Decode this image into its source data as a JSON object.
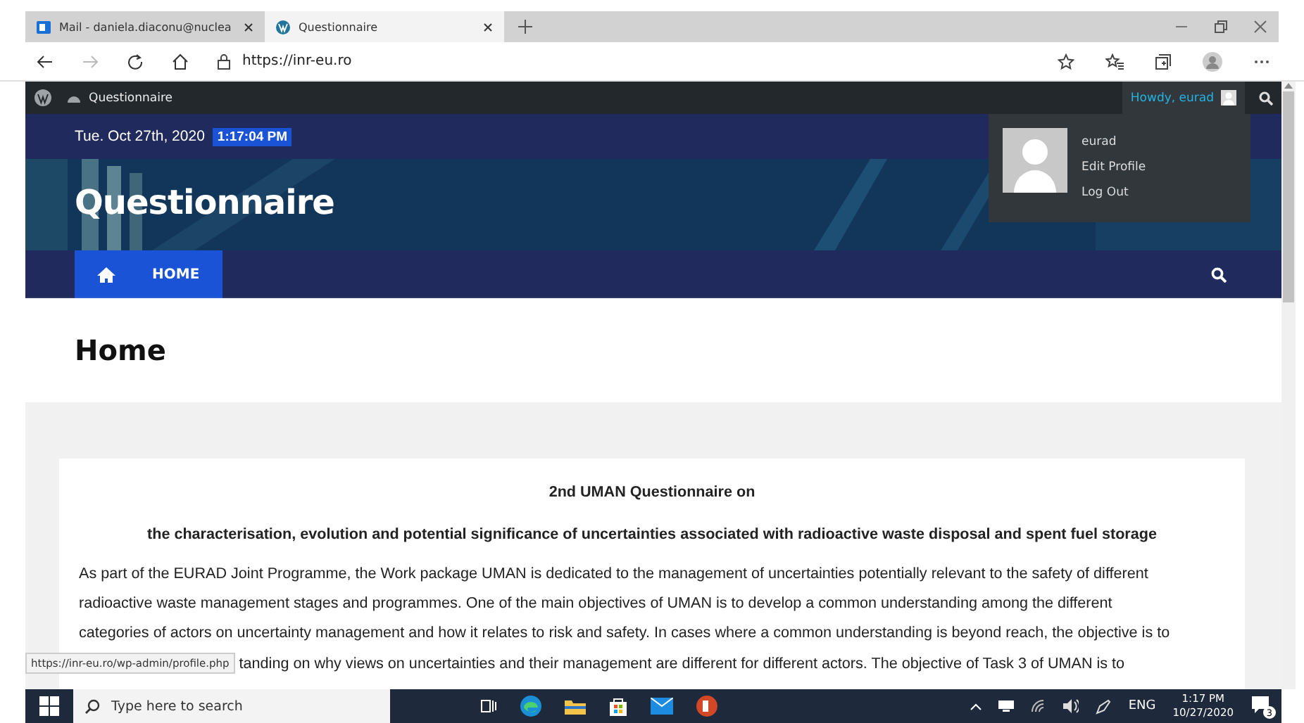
{
  "browser": {
    "tabs": [
      {
        "title": "Mail - daniela.diaconu@nuclea",
        "kind": "mail",
        "selected": false
      },
      {
        "title": "Questionnaire",
        "kind": "wordpress",
        "selected": true
      }
    ],
    "address": "https://inr-eu.ro"
  },
  "admin_bar": {
    "site": "Questionnaire",
    "greeting": "Howdy, eurad"
  },
  "user_menu": {
    "username": "eurad",
    "items": [
      "Edit Profile",
      "Log Out"
    ]
  },
  "site": {
    "date": "Tue. Oct 27th, 2020",
    "time": "1:17:04 PM",
    "title": "Questionnaire",
    "nav": [
      {
        "label": "HOME",
        "selected": true
      }
    ],
    "page_title": "Home"
  },
  "article": {
    "heading": "2nd UMAN Questionnaire on",
    "subheading": "the characterisation, evolution and potential significance of uncertainties associated with radioactive waste disposal and spent fuel storage",
    "lines": [
      "As part of the EURAD Joint Programme, the Work package UMAN is dedicated to the management of uncertainties potentially relevant to the safety of different",
      "radioactive waste management stages and programmes. One of the main objectives of UMAN is to develop a common understanding among the different",
      "categories of actors on uncertainty management and how it relates to risk and safety. In cases where a common understanding is beyond reach, the objective is to"
    ],
    "cut_line": "tanding on why views on uncertainties and their management are different for different actors.  The objective of Task 3 of UMAN is to"
  },
  "status_url": "https://inr-eu.ro/wp-admin/profile.php",
  "taskbar": {
    "search_placeholder": "Type here to search",
    "language": "ENG",
    "time": "1:17 PM",
    "date": "10/27/2020",
    "notifications": "3"
  }
}
